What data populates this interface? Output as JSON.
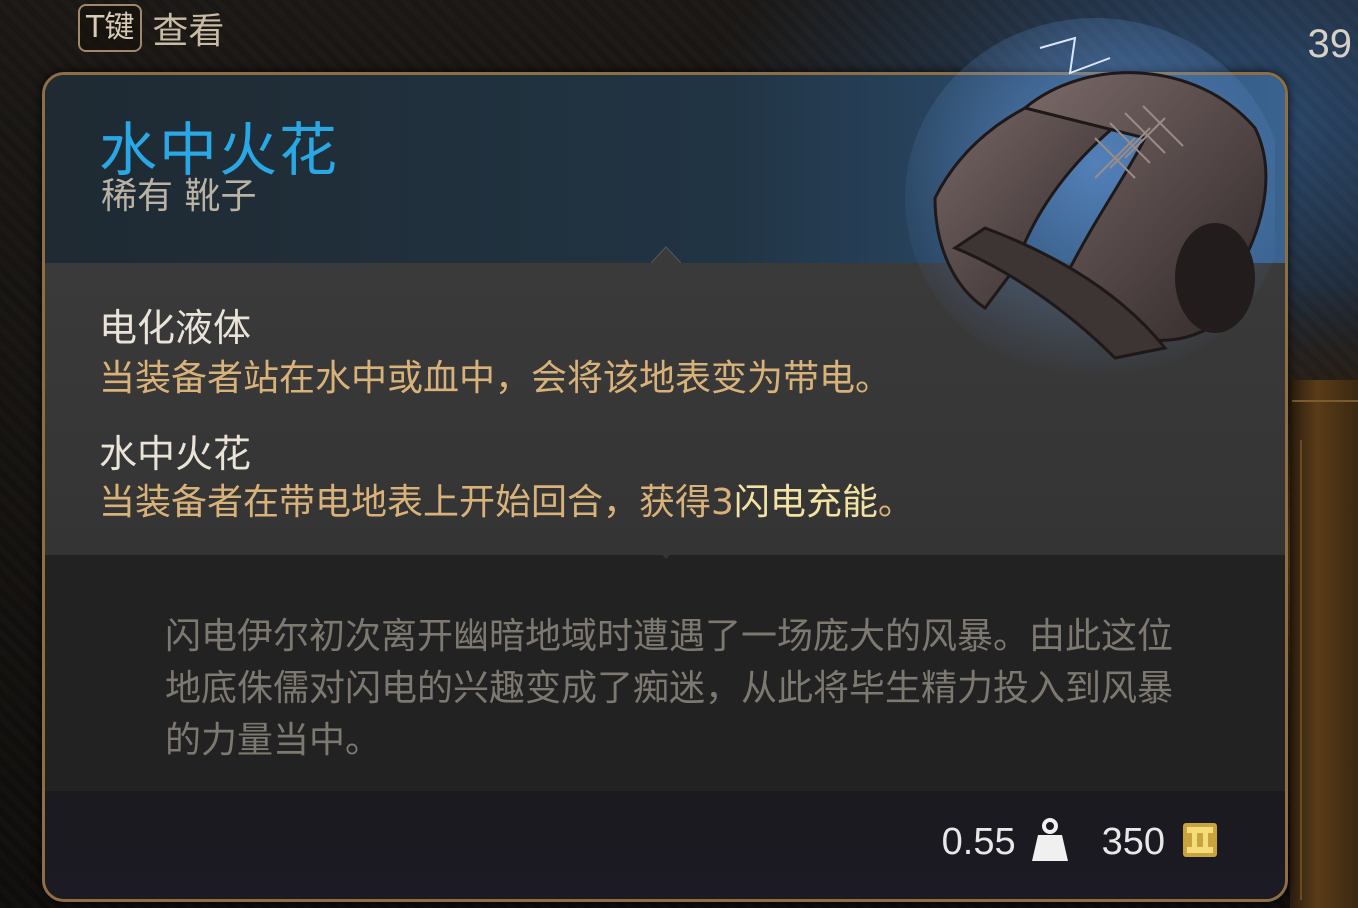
{
  "hint": {
    "key": "T键",
    "label": "查看"
  },
  "corner_number": "39",
  "item": {
    "name": "水中火花",
    "rarity_type": "稀有 靴子",
    "name_color": "#2aa8e6"
  },
  "effects": [
    {
      "title": "电化液体",
      "desc": "当装备者站在水中或血中，会将该地表变为带电。"
    },
    {
      "title": "水中火花",
      "desc_plain": "当装备者在带电地表上开始回合，获得3",
      "desc_highlight": "闪电充能",
      "desc_end": "。"
    }
  ],
  "lore": "闪电伊尔初次离开幽暗地域时遭遇了一场庞大的风暴。由此这位地底侏儒对闪电的兴趣变成了痴迷，从此将毕生精力投入到风暴的力量当中。",
  "footer": {
    "weight": "0.55",
    "weight_icon": "weight-icon",
    "value": "350",
    "value_icon": "gold-coin-icon"
  },
  "colors": {
    "effect_desc": "#d9b27a",
    "highlight": "#f2e2a3",
    "panel_border": "#8d6e45"
  }
}
